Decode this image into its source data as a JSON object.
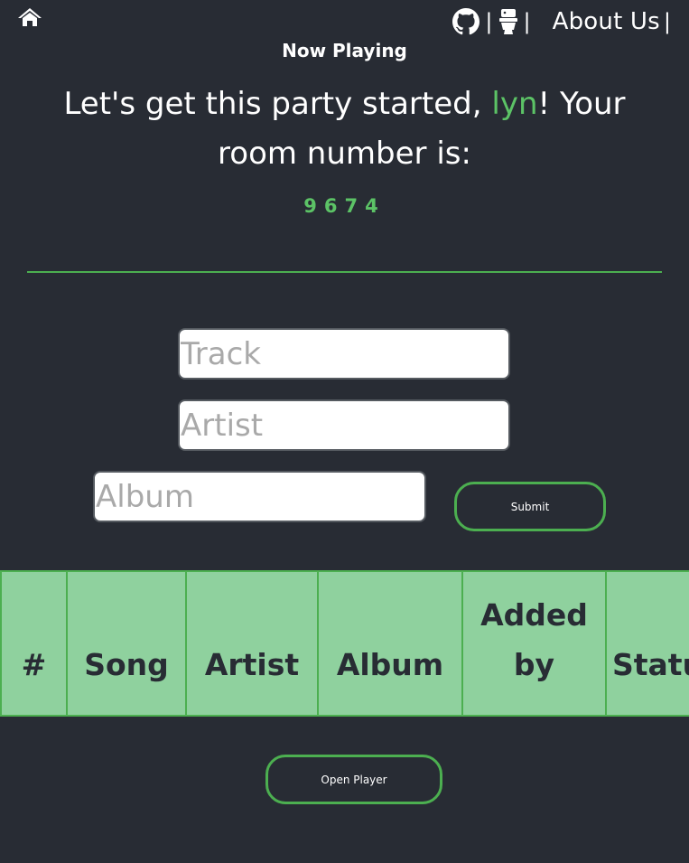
{
  "nav": {
    "home_icon": "home-icon",
    "github_icon": "github-icon",
    "toilet_icon": "toilet-icon",
    "separator": "|",
    "about_label": "About Us"
  },
  "now_playing": "Now Playing",
  "greeting": {
    "prefix": "Let's get this party started, ",
    "username": "lyn",
    "suffix": "! Your room number is:"
  },
  "room_number": "9674",
  "form": {
    "track_placeholder": "Track",
    "artist_placeholder": "Artist",
    "album_placeholder": "Album",
    "submit_label": "Submit"
  },
  "table": {
    "headers": [
      "#",
      "Song",
      "Artist",
      "Album",
      "Added by",
      "Status"
    ]
  },
  "open_player_label": "Open Player",
  "colors": {
    "background": "#282c34",
    "accent": "#4caf50",
    "accent_text": "#5cc366",
    "table_fill": "#8fd19e"
  }
}
